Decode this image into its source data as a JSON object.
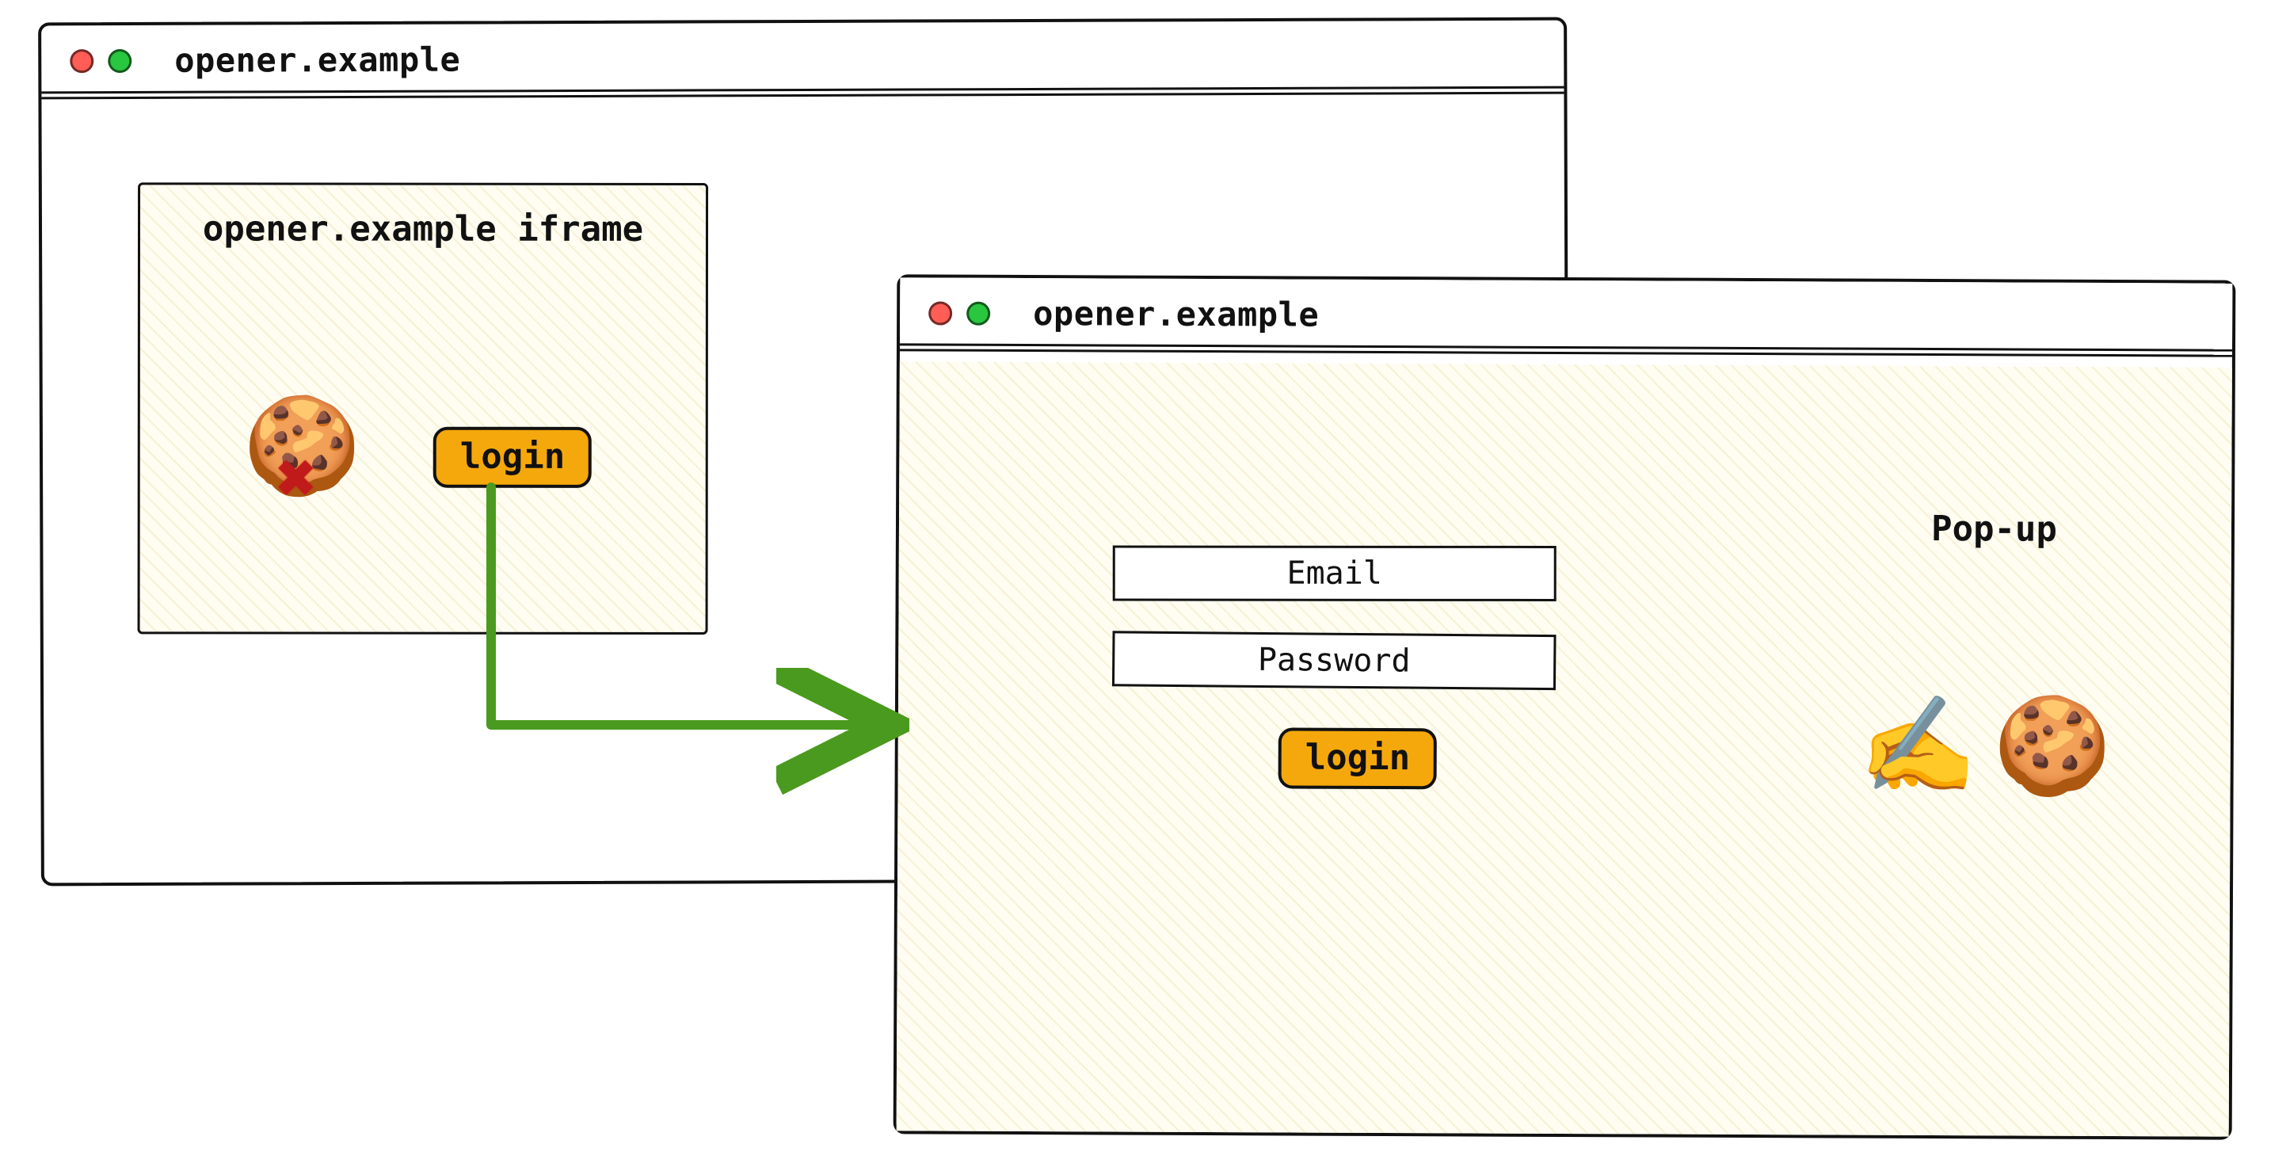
{
  "opener_window": {
    "address": "opener.example",
    "iframe": {
      "title": "opener.example iframe",
      "login_button": "login",
      "cookie_icon": "🍪",
      "blocked_icon": "✖"
    }
  },
  "popup_window": {
    "address": "opener.example",
    "label": "Pop-up",
    "email_field": "Email",
    "password_field": "Password",
    "login_button": "login",
    "writing_icon": "✍️",
    "cookie_icon": "🍪"
  },
  "colors": {
    "accent_button": "#f5a80c",
    "arrow": "#4a9a1f",
    "blocked": "#c11a1a"
  }
}
